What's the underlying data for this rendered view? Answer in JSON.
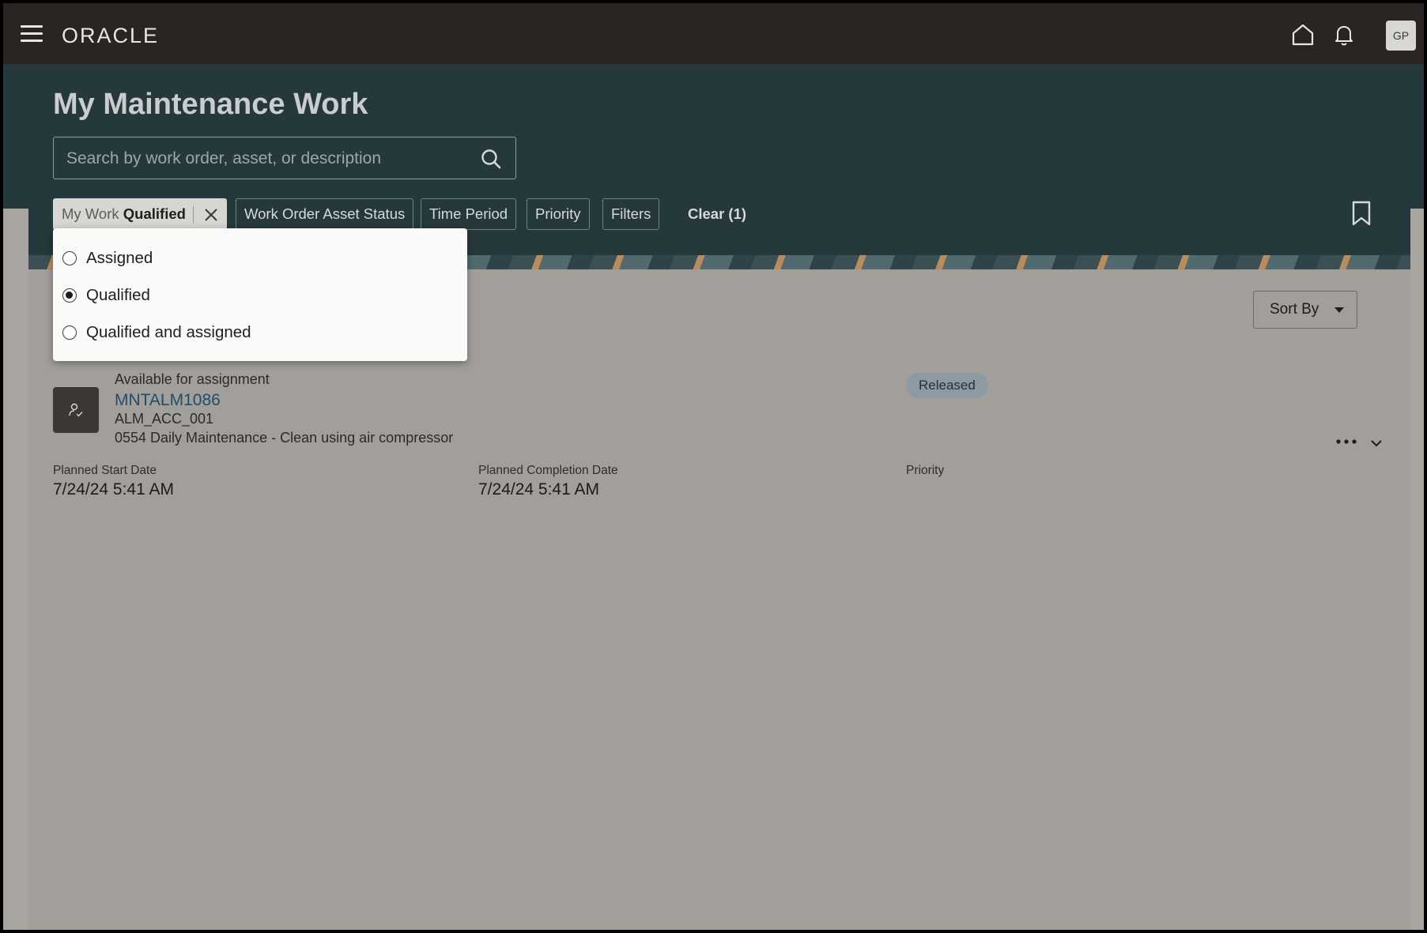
{
  "app": {
    "logo_text": "ORACLE",
    "avatar_initials": "GP"
  },
  "header": {
    "title": "My Maintenance Work",
    "search_placeholder": "Search by work order, asset, or description"
  },
  "filters": {
    "mywork_chip": {
      "label": "My Work",
      "value": "Qualified"
    },
    "chips": [
      "Work Order Asset Status",
      "Time Period",
      "Priority",
      "Filters"
    ],
    "clear_label": "Clear (1)"
  },
  "dropdown": {
    "options": [
      {
        "label": "Assigned",
        "selected": false
      },
      {
        "label": "Qualified",
        "selected": true
      },
      {
        "label": "Qualified and assigned",
        "selected": false
      }
    ]
  },
  "toolbar": {
    "sort_label": "Sort By"
  },
  "work_order": {
    "availability": "Available for assignment",
    "number": "MNTALM1086",
    "asset": "ALM_ACC_001",
    "description": "0554 Daily Maintenance - Clean using air compressor",
    "status": "Released",
    "fields": [
      {
        "label": "Planned Start Date",
        "value": "7/24/24 5:41 AM"
      },
      {
        "label": "Planned Completion Date",
        "value": "7/24/24 5:41 AM"
      },
      {
        "label": "Priority",
        "value": ""
      }
    ]
  },
  "colors": {
    "topbar": "#2a2523",
    "header": "#25383c",
    "overlay_background": "#a39f9b",
    "link": "#1f4d6b",
    "status_badge": "#8d9aa3"
  },
  "icons": [
    "hamburger-icon",
    "home-icon",
    "bell-icon",
    "search-icon",
    "close-icon",
    "bookmark-icon",
    "user-check-icon",
    "more-icon",
    "chevron-down-icon"
  ]
}
